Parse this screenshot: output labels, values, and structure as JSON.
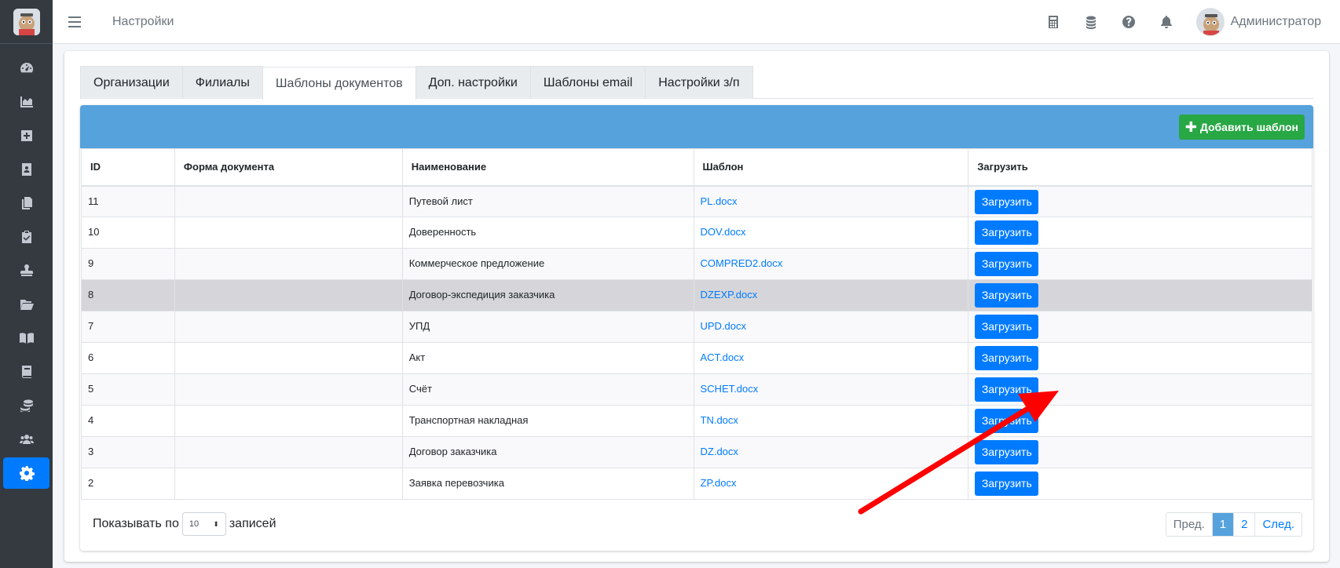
{
  "header": {
    "page_title": "Настройки",
    "user_name": "Администратор"
  },
  "sidebar": {
    "items": [
      {
        "icon": "dashboard-icon"
      },
      {
        "icon": "chart-area-icon"
      },
      {
        "icon": "plus-square-icon"
      },
      {
        "icon": "contact-card-icon"
      },
      {
        "icon": "copy-files-icon"
      },
      {
        "icon": "clipboard-check-icon"
      },
      {
        "icon": "stamp-icon"
      },
      {
        "icon": "folder-open-icon"
      },
      {
        "icon": "book-open-icon"
      },
      {
        "icon": "book-icon"
      },
      {
        "icon": "coins-icon"
      },
      {
        "icon": "users-icon"
      },
      {
        "icon": "gear-icon",
        "active": true
      }
    ]
  },
  "tabs": [
    {
      "label": "Организации"
    },
    {
      "label": "Филиалы"
    },
    {
      "label": "Шаблоны документов",
      "active": true
    },
    {
      "label": "Доп. настройки"
    },
    {
      "label": "Шаблоны email"
    },
    {
      "label": "Настройки з/п"
    }
  ],
  "panel": {
    "add_button": "Добавить шаблон"
  },
  "table": {
    "columns": [
      "ID",
      "Форма документа",
      "Наименование",
      "Шаблон",
      "Загрузить"
    ],
    "upload_label": "Загрузить",
    "rows": [
      {
        "id": "11",
        "form": "",
        "name": "Путевой лист",
        "file": "PL.docx"
      },
      {
        "id": "10",
        "form": "",
        "name": "Доверенность",
        "file": "DOV.docx"
      },
      {
        "id": "9",
        "form": "",
        "name": "Коммерческое предложение",
        "file": "COMPRED2.docx"
      },
      {
        "id": "8",
        "form": "",
        "name": "Договор-экспедиция заказчика",
        "file": "DZEXP.docx"
      },
      {
        "id": "7",
        "form": "",
        "name": "УПД",
        "file": "UPD.docx"
      },
      {
        "id": "6",
        "form": "",
        "name": "Акт",
        "file": "ACT.docx"
      },
      {
        "id": "5",
        "form": "",
        "name": "Счёт",
        "file": "SCHET.docx"
      },
      {
        "id": "4",
        "form": "",
        "name": "Транспортная накладная",
        "file": "TN.docx"
      },
      {
        "id": "3",
        "form": "",
        "name": "Договор заказчика",
        "file": "DZ.docx"
      },
      {
        "id": "2",
        "form": "",
        "name": "Заявка перевозчика",
        "file": "ZP.docx"
      }
    ]
  },
  "footer": {
    "show_label": "Показывать по",
    "per_page": "10",
    "records_label": "записей",
    "prev": "Пред.",
    "pages": [
      "1",
      "2"
    ],
    "next": "След."
  },
  "colors": {
    "sidebar": "#343a40",
    "accent": "#007bff",
    "panel_header": "#56a2dc",
    "add_button": "#28a745",
    "annotation_arrow": "#ff0000"
  }
}
